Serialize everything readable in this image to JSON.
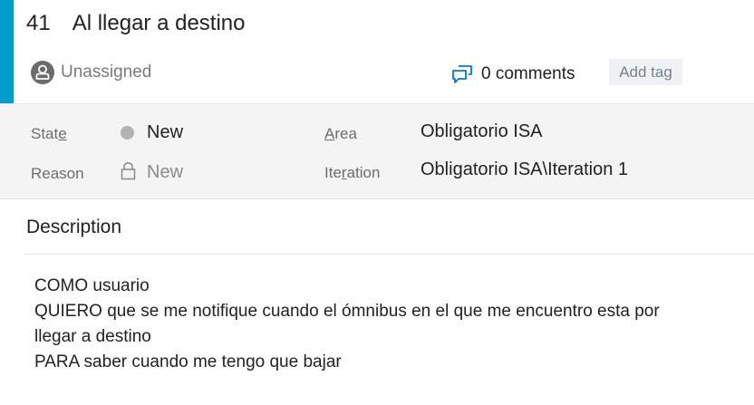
{
  "work_item": {
    "id": "41",
    "title": "Al llegar a destino",
    "accent_color": "#009ccc",
    "assigned_to": "Unassigned",
    "assigned_icon": "user-avatar-icon",
    "comments_label": "0 comments",
    "comments_icon": "comments-icon",
    "add_tag_label": "Add tag"
  },
  "fields": {
    "state": {
      "label_prefix": "Stat",
      "label_access_key": "e",
      "value": "New",
      "indicator_color": "#b2b2b2"
    },
    "reason": {
      "label": "Reason",
      "value": "New",
      "icon": "lock-icon"
    },
    "area": {
      "label_access_key": "A",
      "label_rest": "rea",
      "value": "Obligatorio ISA"
    },
    "iteration": {
      "label_prefix": "Ite",
      "label_access_key": "r",
      "label_rest": "ation",
      "value": "Obligatorio ISA\\Iteration 1"
    }
  },
  "description": {
    "header": "Description",
    "lines": [
      "COMO usuario",
      "QUIERO que se me notifique cuando el ómnibus en el que me encuentro esta por",
      "llegar a destino",
      "PARA saber cuando me tengo que bajar"
    ]
  }
}
